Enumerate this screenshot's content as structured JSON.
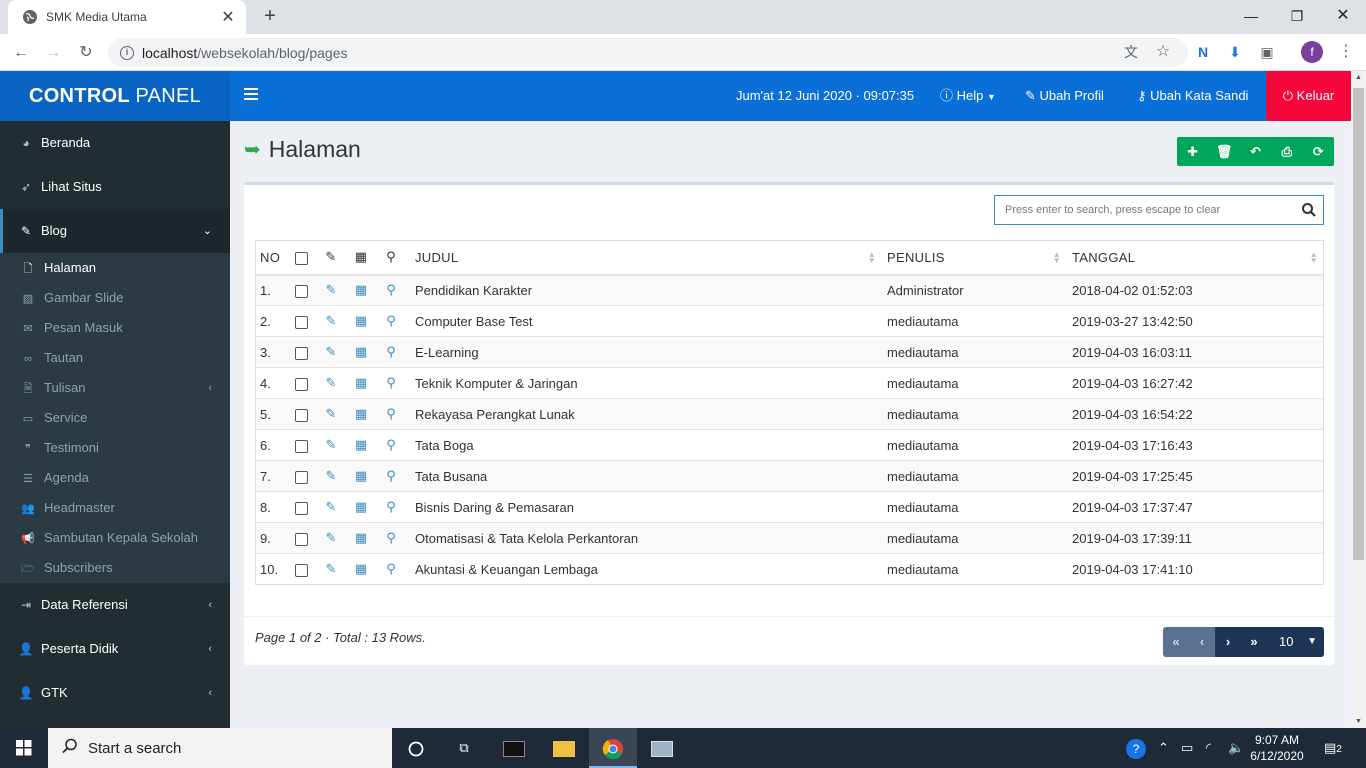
{
  "browser": {
    "tab_title": "SMK Media Utama",
    "url_host": "localhost",
    "url_path": "/websekolah/blog/pages",
    "profile_initial": "f"
  },
  "header": {
    "logo_bold": "CONTROL",
    "logo_light": "PANEL",
    "datetime": "Jum'at 12 Juni 2020 · 09:07:35",
    "help": "Help",
    "edit_profile": "Ubah Profil",
    "change_password": "Ubah Kata Sandi",
    "logout": "Keluar"
  },
  "sidebar": {
    "items": [
      {
        "label": "Beranda",
        "icon": "dashboard-icon"
      },
      {
        "label": "Lihat Situs",
        "icon": "rocket-icon"
      },
      {
        "label": "Blog",
        "icon": "edit-icon"
      },
      {
        "label": "Data Referensi",
        "icon": "sign-in-icon"
      },
      {
        "label": "Peserta Didik",
        "icon": "user-plus-icon"
      },
      {
        "label": "GTK",
        "icon": "user-plus-icon"
      }
    ],
    "blog_sub": [
      {
        "label": "Halaman",
        "icon": "file-icon"
      },
      {
        "label": "Gambar Slide",
        "icon": "image-icon"
      },
      {
        "label": "Pesan Masuk",
        "icon": "envelope-icon"
      },
      {
        "label": "Tautan",
        "icon": "link-icon"
      },
      {
        "label": "Tulisan",
        "icon": "file-text-icon"
      },
      {
        "label": "Service",
        "icon": "desktop-icon"
      },
      {
        "label": "Testimoni",
        "icon": "quote-icon"
      },
      {
        "label": "Agenda",
        "icon": "list-icon"
      },
      {
        "label": "Headmaster",
        "icon": "users-icon"
      },
      {
        "label": "Sambutan Kepala Sekolah",
        "icon": "bullhorn-icon"
      },
      {
        "label": "Subscribers",
        "icon": "folder-icon"
      }
    ]
  },
  "page": {
    "title": "Halaman",
    "search_placeholder": "Press enter to search, press escape to clear"
  },
  "table": {
    "columns": [
      "NO",
      "JUDUL",
      "PENULIS",
      "TANGGAL"
    ],
    "rows": [
      {
        "no": "1.",
        "judul": "Pendidikan Karakter",
        "penulis": "Administrator",
        "tanggal": "2018-04-02 01:52:03"
      },
      {
        "no": "2.",
        "judul": "Computer Base Test",
        "penulis": "mediautama",
        "tanggal": "2019-03-27 13:42:50"
      },
      {
        "no": "3.",
        "judul": "E-Learning",
        "penulis": "mediautama",
        "tanggal": "2019-04-03 16:03:11"
      },
      {
        "no": "4.",
        "judul": "Teknik Komputer & Jaringan",
        "penulis": "mediautama",
        "tanggal": "2019-04-03 16:27:42"
      },
      {
        "no": "5.",
        "judul": "Rekayasa Perangkat Lunak",
        "penulis": "mediautama",
        "tanggal": "2019-04-03 16:54:22"
      },
      {
        "no": "6.",
        "judul": "Tata Boga",
        "penulis": "mediautama",
        "tanggal": "2019-04-03 17:16:43"
      },
      {
        "no": "7.",
        "judul": "Tata Busana",
        "penulis": "mediautama",
        "tanggal": "2019-04-03 17:25:45"
      },
      {
        "no": "8.",
        "judul": "Bisnis Daring & Pemasaran",
        "penulis": "mediautama",
        "tanggal": "2019-04-03 17:37:47"
      },
      {
        "no": "9.",
        "judul": "Otomatisasi & Tata Kelola Perkantoran",
        "penulis": "mediautama",
        "tanggal": "2019-04-03 17:39:11"
      },
      {
        "no": "10.",
        "judul": "Akuntasi & Keuangan Lembaga",
        "penulis": "mediautama",
        "tanggal": "2019-04-03 17:41:10"
      }
    ]
  },
  "footer": {
    "page_info": "Page 1 of 2 · Total : 13 Rows.",
    "page_size": "10"
  },
  "taskbar": {
    "search_placeholder": "Start a search",
    "time": "9:07 AM",
    "date": "6/12/2020",
    "notifications": "2"
  },
  "colors": {
    "brand": "#0b6fd8",
    "logout": "#f5073b",
    "toolbar": "#00a65a",
    "sidebar": "#222d32"
  }
}
